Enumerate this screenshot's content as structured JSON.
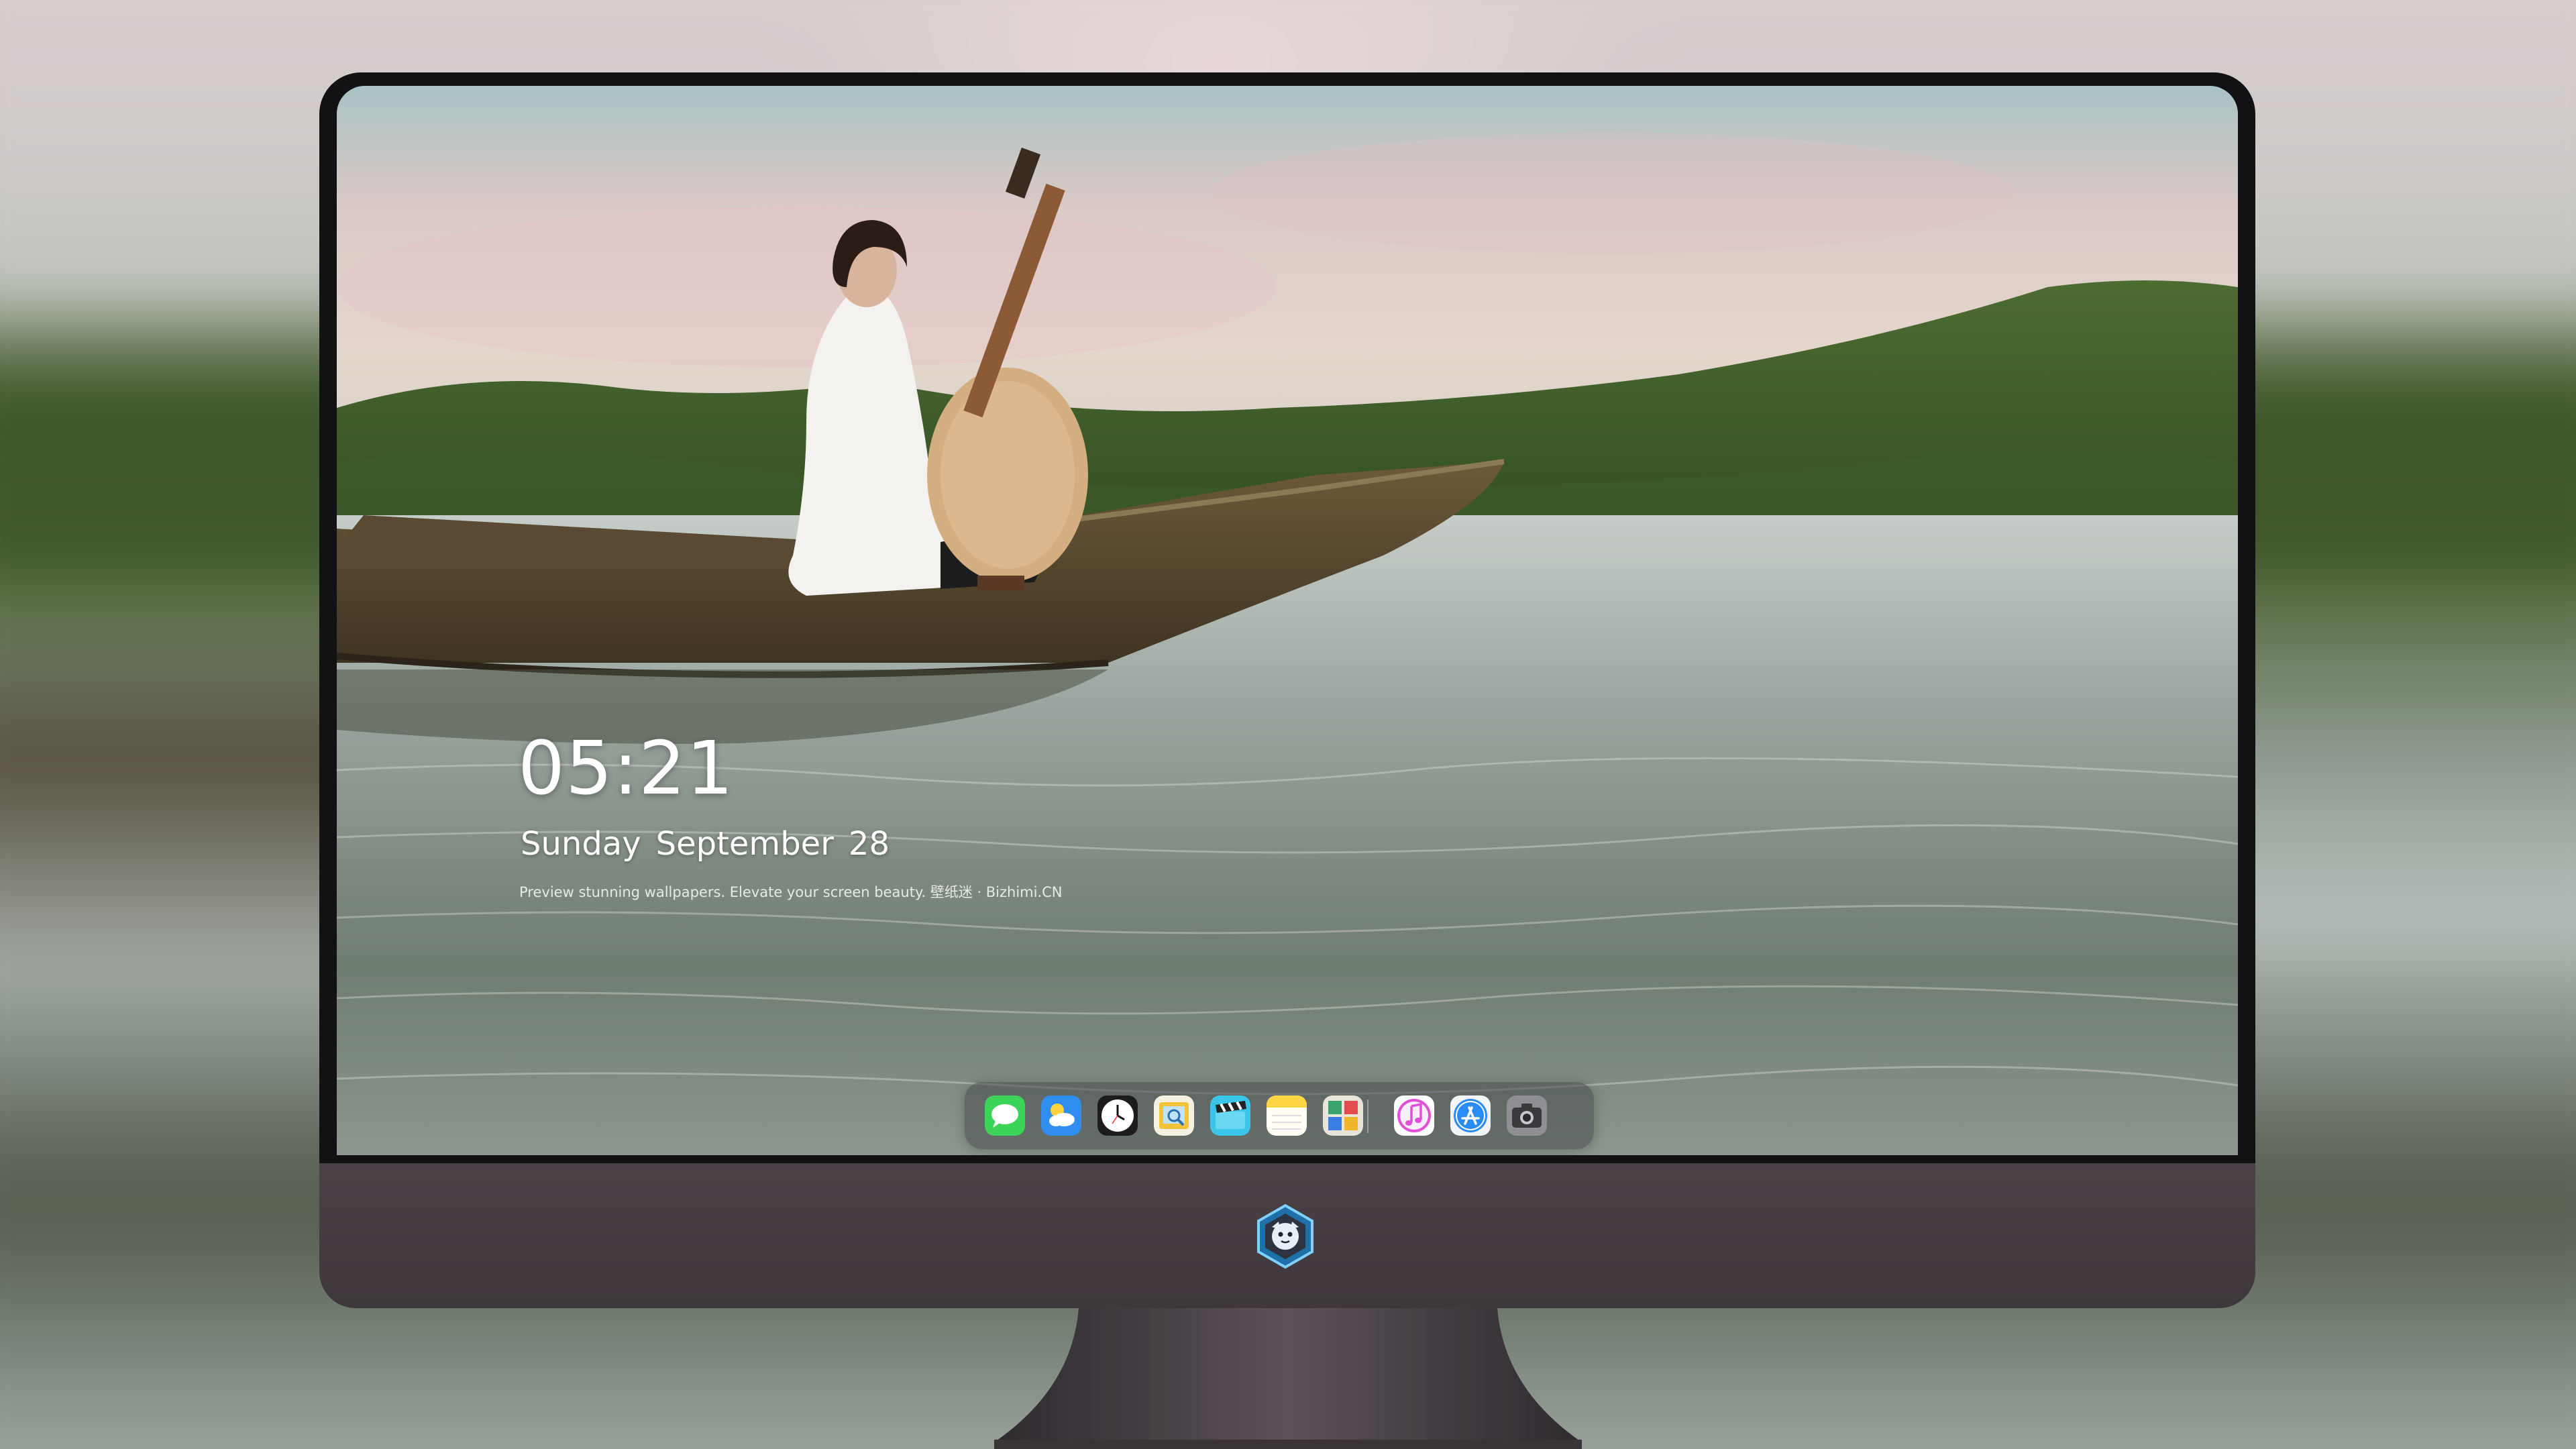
{
  "lock_screen": {
    "time": "05:21",
    "weekday": "Sunday",
    "month": "September",
    "day": "28",
    "tagline": "Preview stunning wallpapers. Elevate your screen beauty. 壁纸迷 · Bizhimi.CN"
  },
  "dock": {
    "apps": [
      {
        "name": "Messages",
        "icon": "messages-icon",
        "color": "#3cd35a"
      },
      {
        "name": "Weather",
        "icon": "weather-icon",
        "color": "#2f8ef0"
      },
      {
        "name": "Clock",
        "icon": "clock-icon",
        "color": "#1c1c1e"
      },
      {
        "name": "Preview",
        "icon": "preview-icon",
        "color": "#f2c33a"
      },
      {
        "name": "Clips",
        "icon": "clapper-icon",
        "color": "#3bc5e8"
      },
      {
        "name": "Notes",
        "icon": "notes-icon",
        "color": "#ffd544"
      },
      {
        "name": "Photo Booth",
        "icon": "photo-booth-icon",
        "color": "#e9e4d8"
      },
      {
        "name": "iTunes",
        "icon": "music-note-icon",
        "color": "#e24ed8"
      },
      {
        "name": "App Store",
        "icon": "app-store-icon",
        "color": "#2a8cf5"
      },
      {
        "name": "Camera",
        "icon": "camera-icon",
        "color": "#8e8e93"
      }
    ]
  },
  "colors": {
    "bezel": "#121214",
    "chin": "#443c42",
    "dock_background": "rgba(70,72,74,0.55)",
    "text": "#ffffff"
  }
}
